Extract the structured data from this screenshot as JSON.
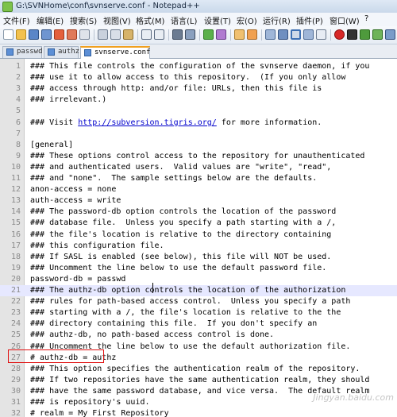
{
  "window": {
    "title": "G:\\SVNHome\\conf\\svnserve.conf - Notepad++"
  },
  "menu": [
    "文件(F)",
    "编辑(E)",
    "搜索(S)",
    "视图(V)",
    "格式(M)",
    "语言(L)",
    "设置(T)",
    "宏(O)",
    "运行(R)",
    "插件(P)",
    "窗口(W)",
    "?"
  ],
  "tabs": [
    {
      "label": "passwd",
      "active": false
    },
    {
      "label": "authz",
      "active": false
    },
    {
      "label": "svnserve.conf",
      "active": true
    }
  ],
  "lines": [
    {
      "n": "1",
      "text": "### This file controls the configuration of the svnserve daemon, if you"
    },
    {
      "n": "2",
      "text": "### use it to allow access to this repository.  (If you only allow"
    },
    {
      "n": "3",
      "text": "### access through http: and/or file: URLs, then this file is"
    },
    {
      "n": "4",
      "text": "### irrelevant.)"
    },
    {
      "n": "5",
      "text": ""
    },
    {
      "n": "6",
      "text": "### Visit http://subversion.tigris.org/ for more information."
    },
    {
      "n": "7",
      "text": ""
    },
    {
      "n": "8",
      "text": "[general]"
    },
    {
      "n": "9",
      "text": "### These options control access to the repository for unauthenticated"
    },
    {
      "n": "10",
      "text": "### and authenticated users.  Valid values are \"write\", \"read\","
    },
    {
      "n": "11",
      "text": "### and \"none\".  The sample settings below are the defaults."
    },
    {
      "n": "12",
      "text": "anon-access = none"
    },
    {
      "n": "13",
      "text": "auth-access = write"
    },
    {
      "n": "14",
      "text": "### The password-db option controls the location of the password"
    },
    {
      "n": "15",
      "text": "### database file.  Unless you specify a path starting with a /,"
    },
    {
      "n": "16",
      "text": "### the file's location is relative to the directory containing"
    },
    {
      "n": "17",
      "text": "### this configuration file."
    },
    {
      "n": "18",
      "text": "### If SASL is enabled (see below), this file will NOT be used."
    },
    {
      "n": "19",
      "text": "### Uncomment the line below to use the default password file."
    },
    {
      "n": "20",
      "text": "password-db = passwd"
    },
    {
      "n": "21",
      "text": "### The authz-db option controls the location of the authorization"
    },
    {
      "n": "22",
      "text": "### rules for path-based access control.  Unless you specify a path"
    },
    {
      "n": "23",
      "text": "### starting with a /, the file's location is relative to the the"
    },
    {
      "n": "24",
      "text": "### directory containing this file.  If you don't specify an"
    },
    {
      "n": "25",
      "text": "### authz-db, no path-based access control is done."
    },
    {
      "n": "26",
      "text": "### Uncomment the line below to use the default authorization file."
    },
    {
      "n": "27",
      "text": "# authz-db = authz"
    },
    {
      "n": "28",
      "text": "### This option specifies the authentication realm of the repository."
    },
    {
      "n": "29",
      "text": "### If two repositories have the same authentication realm, they should"
    },
    {
      "n": "30",
      "text": "### have the same password database, and vice versa.  The default realm"
    },
    {
      "n": "31",
      "text": "### is repository's uuid."
    },
    {
      "n": "32",
      "text": "# realm = My First Repository"
    }
  ],
  "link_text": "http://subversion.tigris.org/",
  "watermark": "Jingyan.baidu.com",
  "colors": {
    "highlight_line": "#e6e8ff",
    "annotation_box": "#e01010",
    "active_tab_accent": "#f0a020"
  }
}
